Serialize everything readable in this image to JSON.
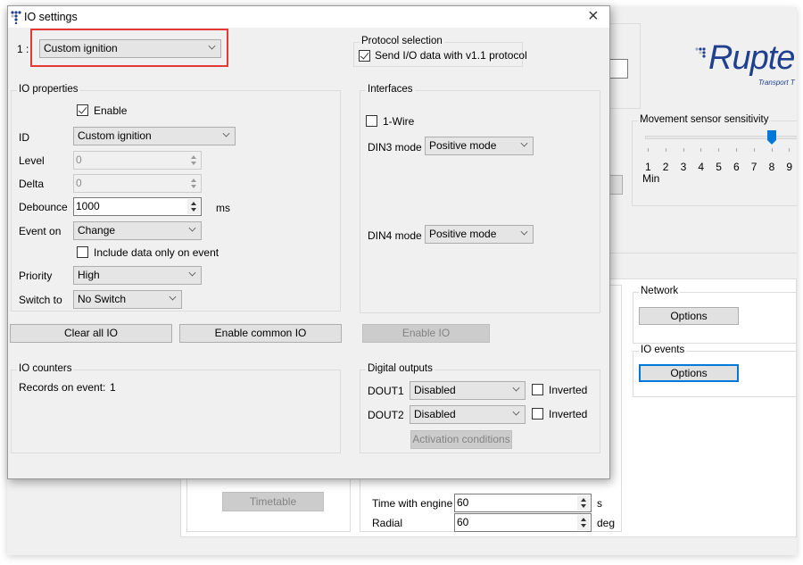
{
  "dialog": {
    "title": "IO settings",
    "close_label": "×",
    "io_index_label": "1  :",
    "io_selector_value": "Custom ignition",
    "protocol_selection": {
      "legend": "Protocol selection",
      "send_v11_label": "Send I/O data with v1.1 protocol",
      "send_v11_checked": true
    },
    "io_properties": {
      "legend": "IO properties",
      "enable_label": "Enable",
      "enable_checked": true,
      "id_label": "ID",
      "id_value": "Custom ignition",
      "level_label": "Level",
      "level_value": "0",
      "delta_label": "Delta",
      "delta_value": "0",
      "debounce_label": "Debounce",
      "debounce_value": "1000",
      "debounce_unit": "ms",
      "event_on_label": "Event on",
      "event_on_value": "Change",
      "include_data_label": "Include data only on event",
      "include_data_checked": false,
      "priority_label": "Priority",
      "priority_value": "High",
      "switch_to_label": "Switch to",
      "switch_to_value": "No Switch"
    },
    "interfaces": {
      "legend": "Interfaces",
      "one_wire_label": "1-Wire",
      "one_wire_checked": false,
      "din3_label": "DIN3 mode",
      "din3_value": "Positive mode",
      "din4_label": "DIN4 mode",
      "din4_value": "Positive mode"
    },
    "buttons": {
      "clear_all": "Clear all IO",
      "enable_common": "Enable common IO",
      "enable_io": "Enable IO"
    },
    "io_counters": {
      "legend": "IO counters",
      "records_label": "Records on event:",
      "records_value": "1"
    },
    "digital_outputs": {
      "legend": "Digital outputs",
      "dout1_label": "DOUT1",
      "dout1_value": "Disabled",
      "dout2_label": "DOUT2",
      "dout2_value": "Disabled",
      "inverted_label": "Inverted",
      "dout1_inverted": false,
      "dout2_inverted": false,
      "activation_conditions": "Activation conditions"
    }
  },
  "background": {
    "logo_text": "Rupte",
    "logo_subtext": "Transport T",
    "movement_sensor": {
      "legend": "Movement sensor sensitivity",
      "ticks": [
        "1",
        "2",
        "3",
        "4",
        "5",
        "6",
        "7",
        "8",
        "9"
      ],
      "min_label": "Min",
      "value": 8
    },
    "network": {
      "legend": "Network",
      "options_label": "Options"
    },
    "io_events": {
      "legend": "IO events",
      "options_label": "Options"
    },
    "timetable_label": "Timetable",
    "time_with_engine_label": "Time with engine",
    "time_with_engine_value": "60",
    "time_with_engine_unit": "s",
    "radial_label": "Radial",
    "radial_value": "60",
    "radial_unit": "deg"
  },
  "colors": {
    "accent": "#0078d7",
    "highlight": "#e53935",
    "logo_blue": "#1f3f8f"
  }
}
